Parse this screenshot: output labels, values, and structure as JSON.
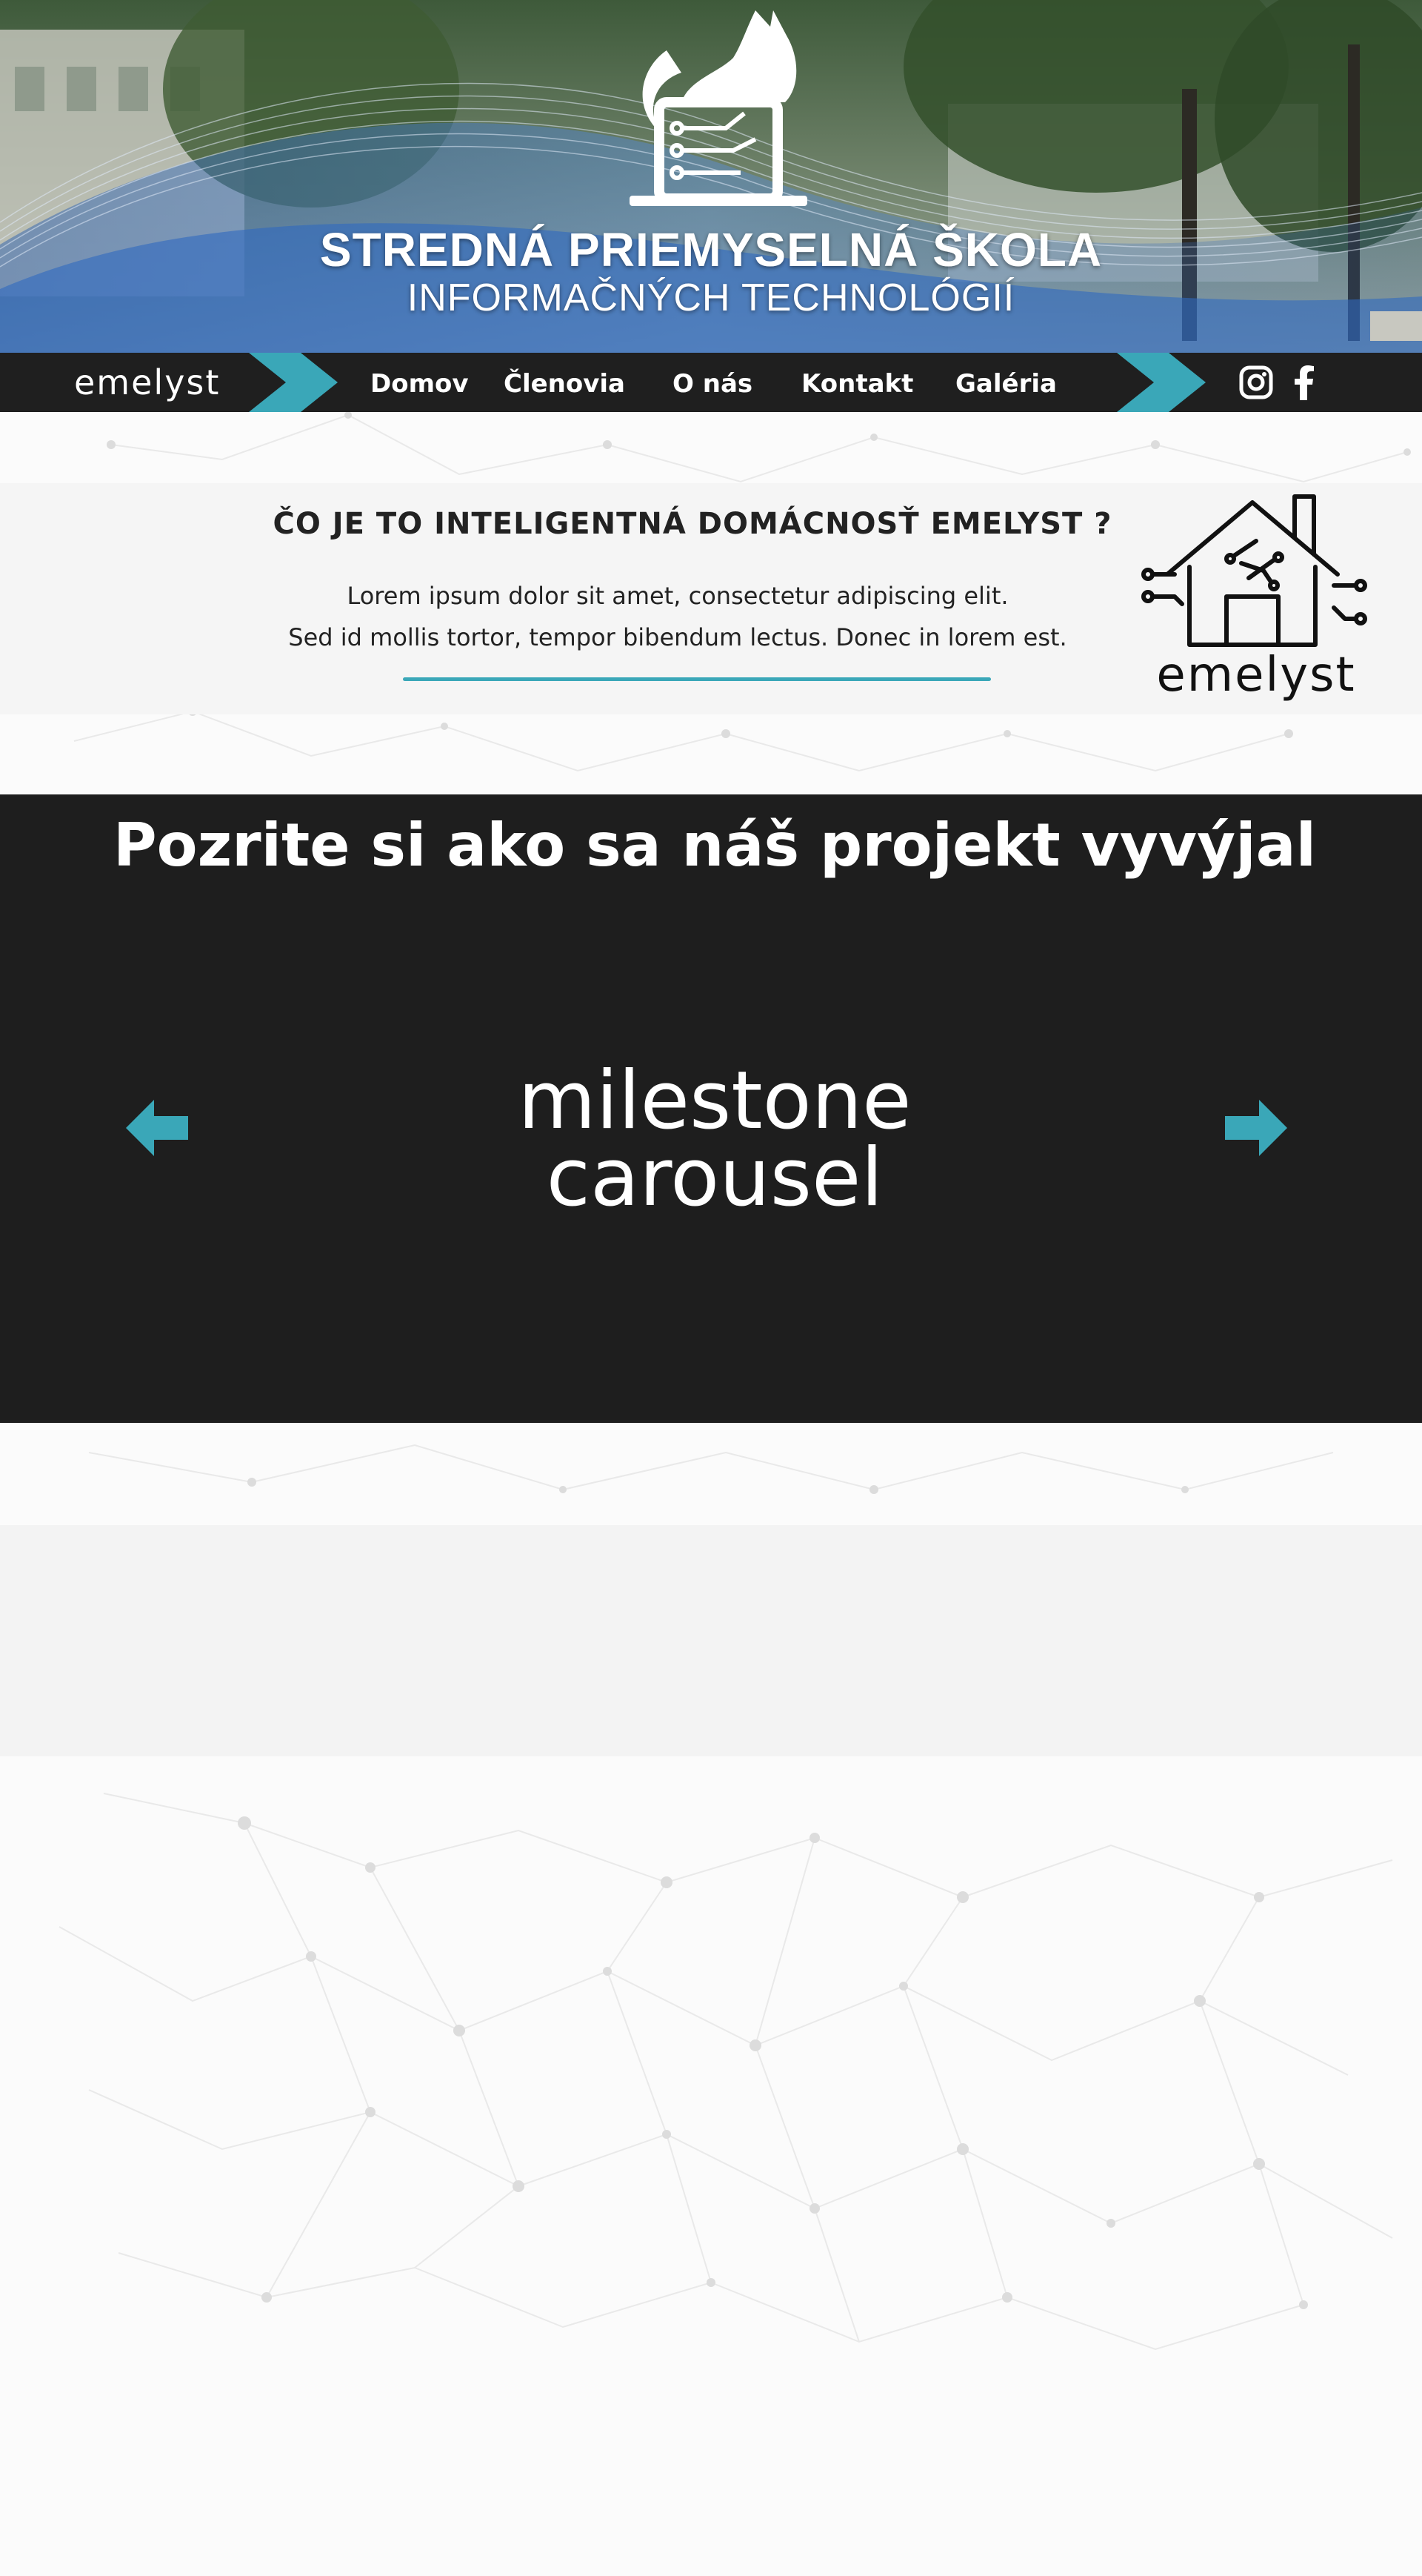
{
  "hero": {
    "school_name": "STREDNÁ PRIEMYSELNÁ ŠKOLA",
    "school_subtitle": "INFORMAČNÝCH TECHNOLÓGIÍ"
  },
  "nav": {
    "brand": "emelyst",
    "links": [
      {
        "label": "Domov"
      },
      {
        "label": "Členovia"
      },
      {
        "label": "O nás"
      },
      {
        "label": "Kontakt"
      },
      {
        "label": "Galéria"
      }
    ],
    "social": [
      "instagram-icon",
      "facebook-icon"
    ]
  },
  "info": {
    "title": "ČO JE TO INTELIGENTNÁ DOMÁCNOSŤ EMELYST ?",
    "line1": "Lorem ipsum dolor sit amet, consectetur adipiscing elit.",
    "line2": "Sed id mollis tortor, tempor bibendum lectus. Donec in lorem est.",
    "logo_text": "emelyst"
  },
  "milestones": {
    "title": "Pozrite si ako sa náš projekt vyvýjal",
    "carousel_line1": "milestone",
    "carousel_line2": "carousel",
    "prev_icon": "arrow-left-icon",
    "next_icon": "arrow-right-icon"
  },
  "colors": {
    "accent": "#3aa7b8",
    "dark": "#1e1e1e",
    "nav": "#1f1f1f"
  }
}
